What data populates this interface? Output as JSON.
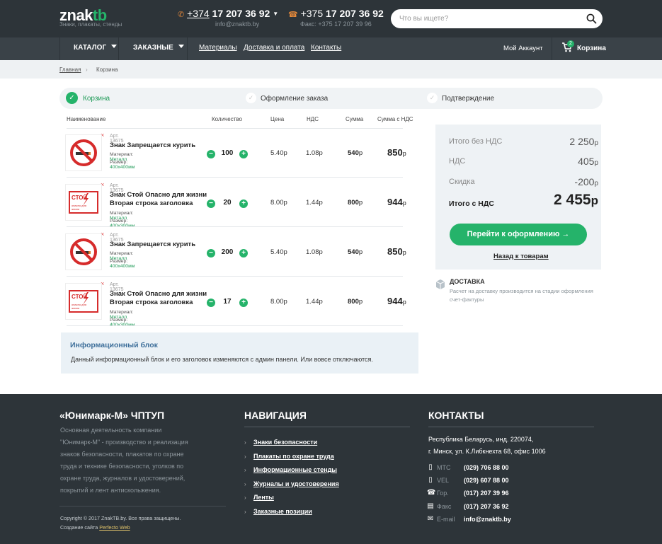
{
  "header": {
    "logo_main": "znak",
    "logo_accent": "tb",
    "tagline": "Знаки, плакаты, стенды",
    "phone1_prefix": "+374",
    "phone1_number": "17 207 36 92",
    "email": "info@znaktb.by",
    "phone2_prefix": "+375",
    "phone2_number": "17 207 36 92",
    "fax": "Факс: +375 17 207 39 96",
    "search_placeholder": "Что вы ищете?"
  },
  "nav": {
    "catalog": "КАТАЛОГ",
    "custom": "ЗАКАЗНЫЕ",
    "links": [
      "Материалы",
      "Доставка и оплата",
      "Контакты"
    ],
    "account": "Мой Аккаунт",
    "cart": "Корзина",
    "cart_count": "2"
  },
  "breadcrumb": [
    "Главная",
    "Корзина"
  ],
  "steps": [
    "Корзина",
    "Оформление заказа",
    "Подтверждение"
  ],
  "table": {
    "headers": [
      "Наименование",
      "Количество",
      "Цена",
      "НДС",
      "Сумма",
      "Сумма с НДС"
    ],
    "rows": [
      {
        "art": "Арт. 13675",
        "name1": "Знак Запрещается курить",
        "name2": "",
        "material_label": "Материал:",
        "material": "Металл",
        "size_label": "Размер:",
        "size": "400х400мм",
        "qty": "100",
        "price": "5.40",
        "vat": "1.08",
        "sum": "540",
        "total": "850",
        "cur": "р",
        "icon": "no-smoking-sign"
      },
      {
        "art": "Арт. 13675",
        "name1": "Знак Стой Опасно для жизни",
        "name2": "Вторая строка заголовка",
        "material_label": "Материал:",
        "material": "Металл",
        "size_label": "Размер:",
        "size": "400х300мм",
        "qty": "20",
        "price": "8.00",
        "vat": "1.44",
        "sum": "800",
        "total": "944",
        "cur": "р",
        "icon": "high-voltage-sign"
      },
      {
        "art": "Арт. 13675",
        "name1": "Знак Запрещается курить",
        "name2": "",
        "material_label": "Материал:",
        "material": "Металл",
        "size_label": "Размер:",
        "size": "400х400мм",
        "qty": "200",
        "price": "5.40",
        "vat": "1.08",
        "sum": "540",
        "total": "850",
        "cur": "р",
        "icon": "no-smoking-sign"
      },
      {
        "art": "Арт. 13675",
        "name1": "Знак Стой Опасно для жизни",
        "name2": "Вторая строка заголовка",
        "material_label": "Материал:",
        "material": "Металл",
        "size_label": "Размер:",
        "size": "400х300мм",
        "qty": "17",
        "price": "8.00",
        "vat": "1.44",
        "sum": "800",
        "total": "944",
        "cur": "р",
        "icon": "high-voltage-sign"
      }
    ],
    "sign_text1": "СТОЙ",
    "sign_text2": "опасно для жизни"
  },
  "summary": {
    "no_vat_label": "Итого без НДС",
    "no_vat_value": "2 250",
    "vat_label": "НДС",
    "vat_value": "405",
    "discount_label": "Скидка",
    "discount_value": "-200",
    "total_label": "Итого с НДС",
    "total_value": "2 455",
    "cur": "р",
    "checkout": "Перейти к оформлению →",
    "back": "Назад к товарам"
  },
  "delivery": {
    "title": "ДОСТАВКА",
    "text": "Расчет на доставку производится на стадии оформления счет-фактуры"
  },
  "info_block": {
    "title": "Информационный блок",
    "text": "Данный информационный блок и его заголовок изменяются с админ панели. Или вовсе отключаются."
  },
  "footer": {
    "company_title": "«Юнимарк-М» ЧПТУП",
    "company_text": [
      "Основная деятельность компании",
      "\"Юнимарк-М\" - производство и реализация",
      "знаков безопасности, плакатов по охране",
      "труда и технике безопасности, уголков по",
      "охране труда, журналов и удостоверений,",
      "покрытий и лент антискольжения."
    ],
    "copyright": "Copyright © 2017 ZnakTB.by. Все права защищены.",
    "made_by": "Создание сайта",
    "made_by_link": "Perfecto Web",
    "nav_title": "НАВИГАЦИЯ",
    "nav_items": [
      "Знаки безопасности",
      "Плакаты по охране труда",
      "Информационные стенды",
      "Журналы и удостоверения",
      "Ленты",
      "Заказные позиции"
    ],
    "contacts_title": "КОНТАКТЫ",
    "address1": "Республика Беларусь, инд. 220074,",
    "address2": "г. Минск, ул. К.Либкнехта 68, офис 1006",
    "contacts": [
      {
        "label": "МТС",
        "value": "(029) 706 88 00",
        "icon": "mobile-icon"
      },
      {
        "label": "VEL",
        "value": "(029) 607 88 00",
        "icon": "mobile-icon"
      },
      {
        "label": "Гор.",
        "value": "(017) 207 39 96",
        "icon": "phone-icon"
      },
      {
        "label": "Факс",
        "value": "(017) 207 36 92",
        "icon": "fax-icon"
      },
      {
        "label": "E-mail",
        "value": "info@znaktb.by",
        "icon": "mail-icon"
      }
    ]
  },
  "colors": {
    "accent": "#25b36a",
    "dark": "#2d3439",
    "nav": "#3a4248"
  }
}
